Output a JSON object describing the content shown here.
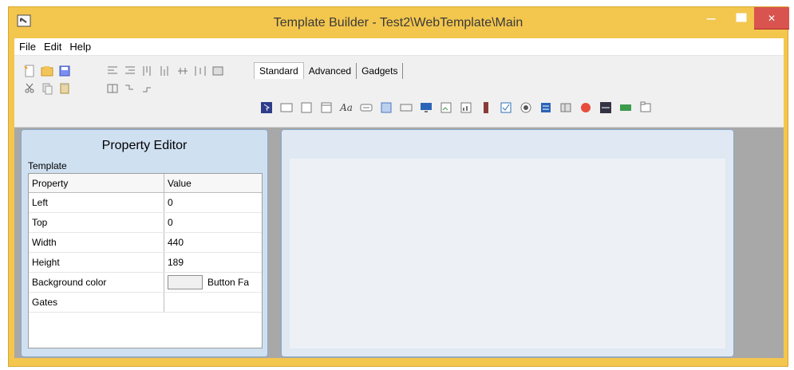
{
  "window": {
    "title": "Template Builder - Test2\\WebTemplate\\Main",
    "buttons": {
      "minimize": "–",
      "maximize": "□",
      "close": "✕"
    }
  },
  "menubar": {
    "items": [
      "File",
      "Edit",
      "Help"
    ]
  },
  "toolbar": {
    "tabs": [
      "Standard",
      "Advanced",
      "Gadgets"
    ],
    "active_tab": "Standard"
  },
  "property_editor": {
    "title": "Property Editor",
    "section": "Template",
    "headers": {
      "property": "Property",
      "value": "Value"
    },
    "rows": [
      {
        "property": "Left",
        "value": "0"
      },
      {
        "property": "Top",
        "value": "0"
      },
      {
        "property": "Width",
        "value": "440"
      },
      {
        "property": "Height",
        "value": "189"
      },
      {
        "property": "Background color",
        "value": "Button Fa"
      },
      {
        "property": "Gates",
        "value": ""
      }
    ]
  }
}
